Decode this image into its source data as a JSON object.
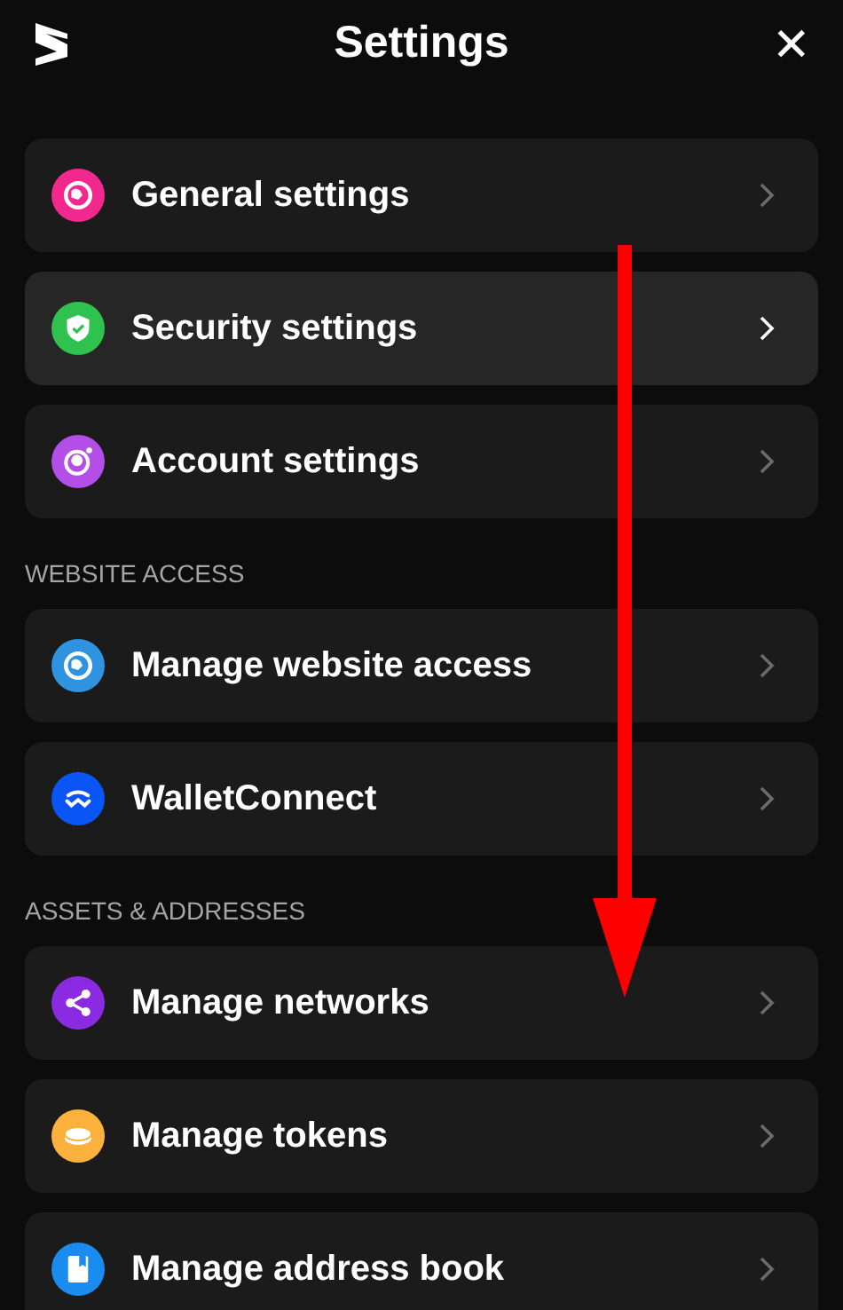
{
  "header": {
    "title": "Settings",
    "close": "✕"
  },
  "sections": [
    {
      "items": [
        {
          "label": "General settings",
          "kind": "globe",
          "color": "#f2288f",
          "selected": false
        },
        {
          "label": "Security settings",
          "kind": "shield",
          "color": "#2fc24e",
          "selected": true
        },
        {
          "label": "Account settings",
          "kind": "account",
          "color": "#b44ee8",
          "selected": false
        }
      ]
    },
    {
      "heading": "WEBSITE ACCESS",
      "items": [
        {
          "label": "Manage website access",
          "kind": "globe",
          "color": "#2f93e0",
          "selected": false
        },
        {
          "label": "WalletConnect",
          "kind": "wave",
          "color": "#0a55f5",
          "selected": false
        }
      ]
    },
    {
      "heading": "ASSETS & ADDRESSES",
      "items": [
        {
          "label": "Manage networks",
          "kind": "share",
          "color": "#8a2be2",
          "selected": false
        },
        {
          "label": "Manage tokens",
          "kind": "coin",
          "color": "#fbb13c",
          "selected": false
        },
        {
          "label": "Manage address book",
          "kind": "book",
          "color": "#1a8cf0",
          "selected": false
        }
      ]
    }
  ]
}
